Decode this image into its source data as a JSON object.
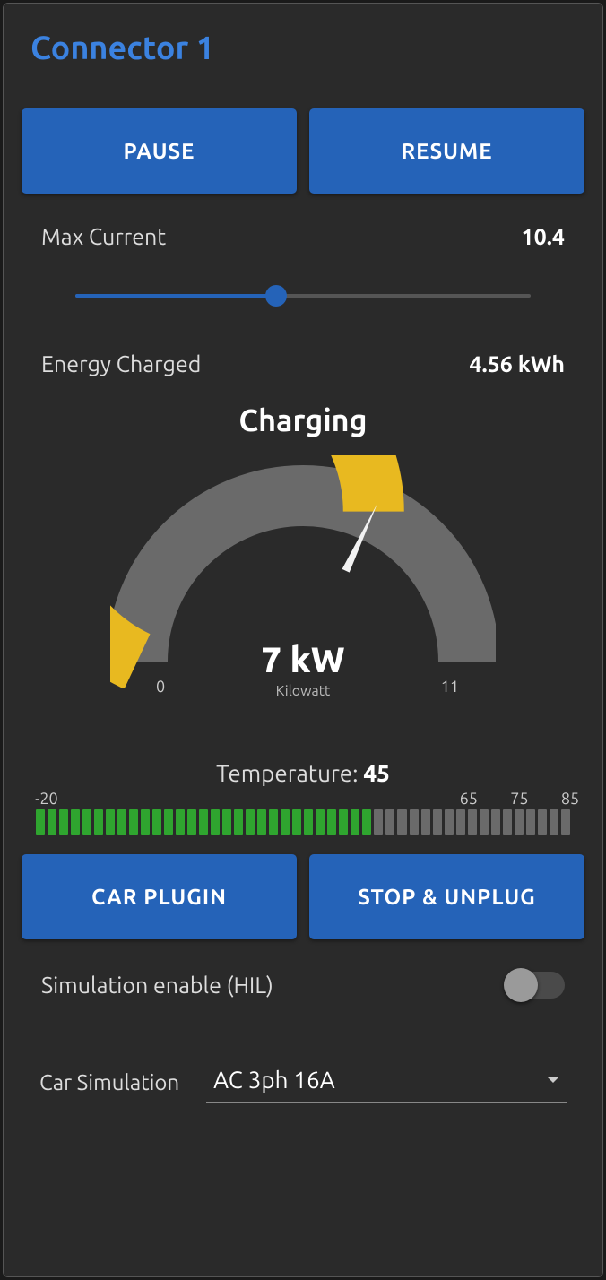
{
  "title": "Connector 1",
  "buttons": {
    "pause": "PAUSE",
    "resume": "RESUME",
    "plugin": "CAR PLUGIN",
    "unplug": "STOP & UNPLUG"
  },
  "maxCurrent": {
    "label": "Max Current",
    "value": "10.4",
    "sliderPercent": 44
  },
  "energy": {
    "label": "Energy Charged",
    "value": "4.56 kWh"
  },
  "gauge": {
    "status": "Charging",
    "value": "7 kW",
    "unit": "Kilowatt",
    "min": "0",
    "max": "11",
    "percent": 64
  },
  "temperature": {
    "labelPrefix": "Temperature: ",
    "value": "45",
    "ticks": [
      "-20",
      "65",
      "75",
      "85"
    ],
    "tickPositions": [
      2,
      81,
      90.5,
      100
    ],
    "fillPercent": 62,
    "segments": 46
  },
  "simEnable": {
    "label": "Simulation enable (HIL)",
    "on": false
  },
  "carSim": {
    "label": "Car Simulation",
    "selected": "AC 3ph 16A"
  },
  "chart_data": {
    "type": "other",
    "gauge": {
      "min": 0,
      "max": 11,
      "value": 7,
      "unit": "kW"
    },
    "temperature": {
      "min": -20,
      "max": 85,
      "value": 45
    }
  }
}
